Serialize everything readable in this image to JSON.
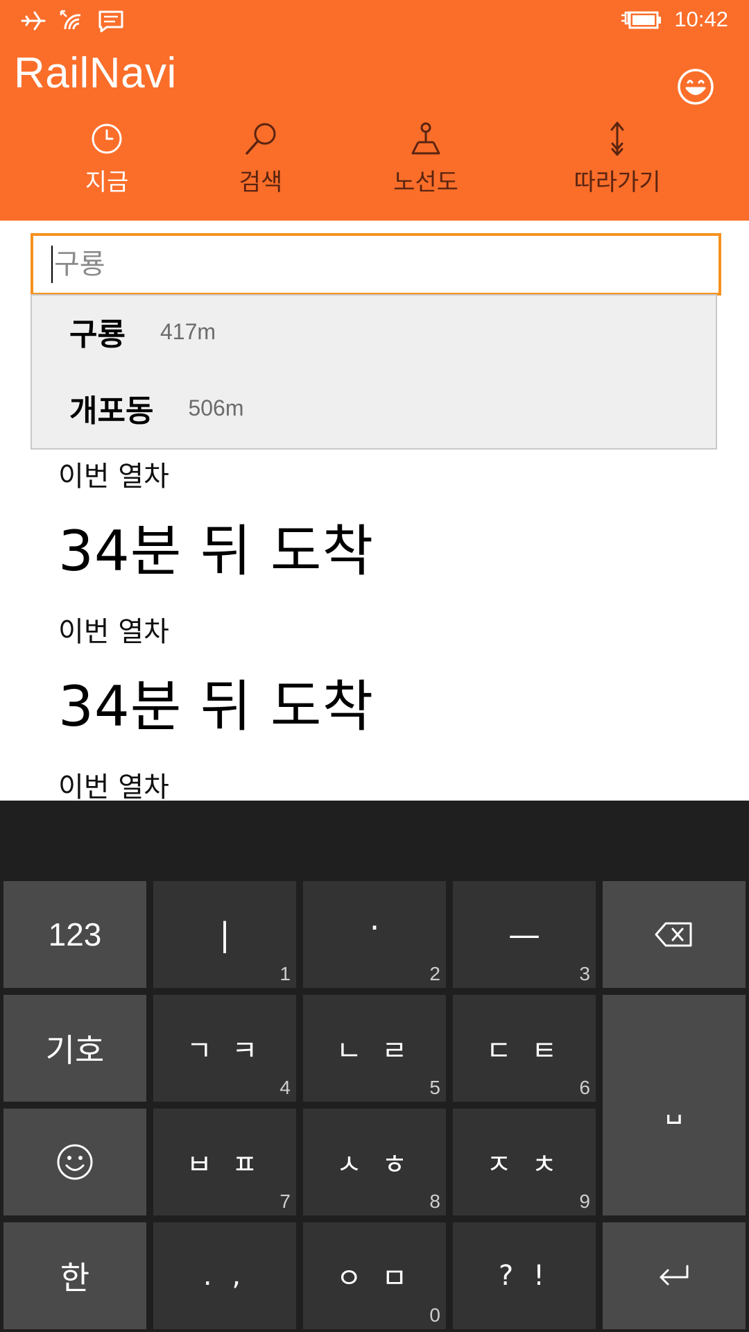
{
  "status": {
    "time": "10:42"
  },
  "app": {
    "title": "RailNavi"
  },
  "nav": [
    {
      "label": "지금",
      "icon": "clock-icon"
    },
    {
      "label": "검색",
      "icon": "search-icon"
    },
    {
      "label": "노선도",
      "icon": "map-pin-icon"
    },
    {
      "label": "따라가기",
      "icon": "follow-arrow-icon"
    }
  ],
  "search": {
    "value": "",
    "placeholder": "구룡"
  },
  "suggestions": [
    {
      "name": "구룡",
      "distance": "417m"
    },
    {
      "name": "개포동",
      "distance": "506m"
    }
  ],
  "arrivals": [
    {
      "label": "이번 열차",
      "time": "34분 뒤 도착"
    },
    {
      "label": "이번 열차",
      "time": "34분 뒤 도착"
    },
    {
      "label": "이번 열차"
    }
  ],
  "keyboard": {
    "numbers_key": "123",
    "symbols_key": "기호",
    "language_key": "한",
    "keys": [
      {
        "label": "|",
        "num": "1"
      },
      {
        "label": "·",
        "num": "2"
      },
      {
        "label": "—",
        "num": "3"
      },
      {
        "label": "ㄱ ㅋ",
        "num": "4"
      },
      {
        "label": "ㄴ ㄹ",
        "num": "5"
      },
      {
        "label": "ㄷ ㅌ",
        "num": "6"
      },
      {
        "label": "ㅂ ㅍ",
        "num": "7"
      },
      {
        "label": "ㅅ ㅎ",
        "num": "8"
      },
      {
        "label": "ㅈ ㅊ",
        "num": "9"
      },
      {
        "label": ". ,",
        "num": ""
      },
      {
        "label": "ㅇ ㅁ",
        "num": "0"
      },
      {
        "label": "? !",
        "num": ""
      }
    ],
    "space_key": "␣",
    "colors": {
      "background": "#1f1f1f",
      "key_dark": "#333333",
      "key_light": "#4a4a4a"
    }
  },
  "colors": {
    "accent": "#fa6e2a",
    "search_border": "#f5921f"
  }
}
